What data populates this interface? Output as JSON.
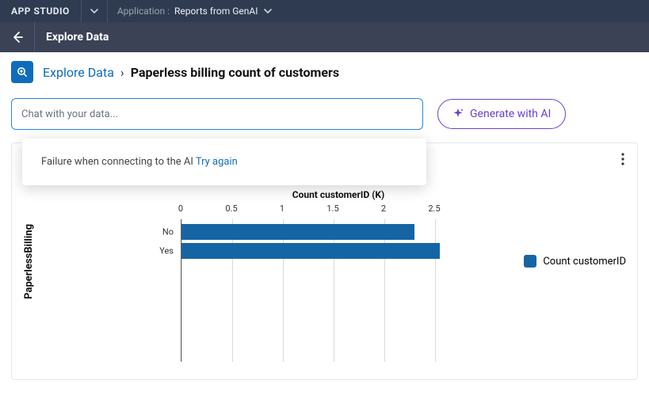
{
  "topbar": {
    "brand": "APP STUDIO",
    "app_label": "Application :",
    "app_value": "Reports from GenAI"
  },
  "subbar": {
    "title": "Explore Data"
  },
  "breadcrumb": {
    "root": "Explore Data",
    "sep": "›",
    "leaf": "Paperless billing count of customers"
  },
  "chat": {
    "placeholder": "Chat with your data...",
    "value": ""
  },
  "generate_label": "Generate with AI",
  "popover": {
    "msg": "Failure when connecting to the AI ",
    "retry": "Try again"
  },
  "chart_data": {
    "type": "bar",
    "orientation": "horizontal",
    "title": "Count customerID (K)",
    "yaxis_title": "PaperlessBilling",
    "categories": [
      "No",
      "Yes"
    ],
    "values": [
      2.3,
      2.55
    ],
    "xticks": [
      0,
      0.5,
      1,
      1.5,
      2,
      2.5
    ],
    "xlim": [
      0,
      2.5
    ],
    "legend": "Count customerID",
    "color": "#1565a5"
  }
}
